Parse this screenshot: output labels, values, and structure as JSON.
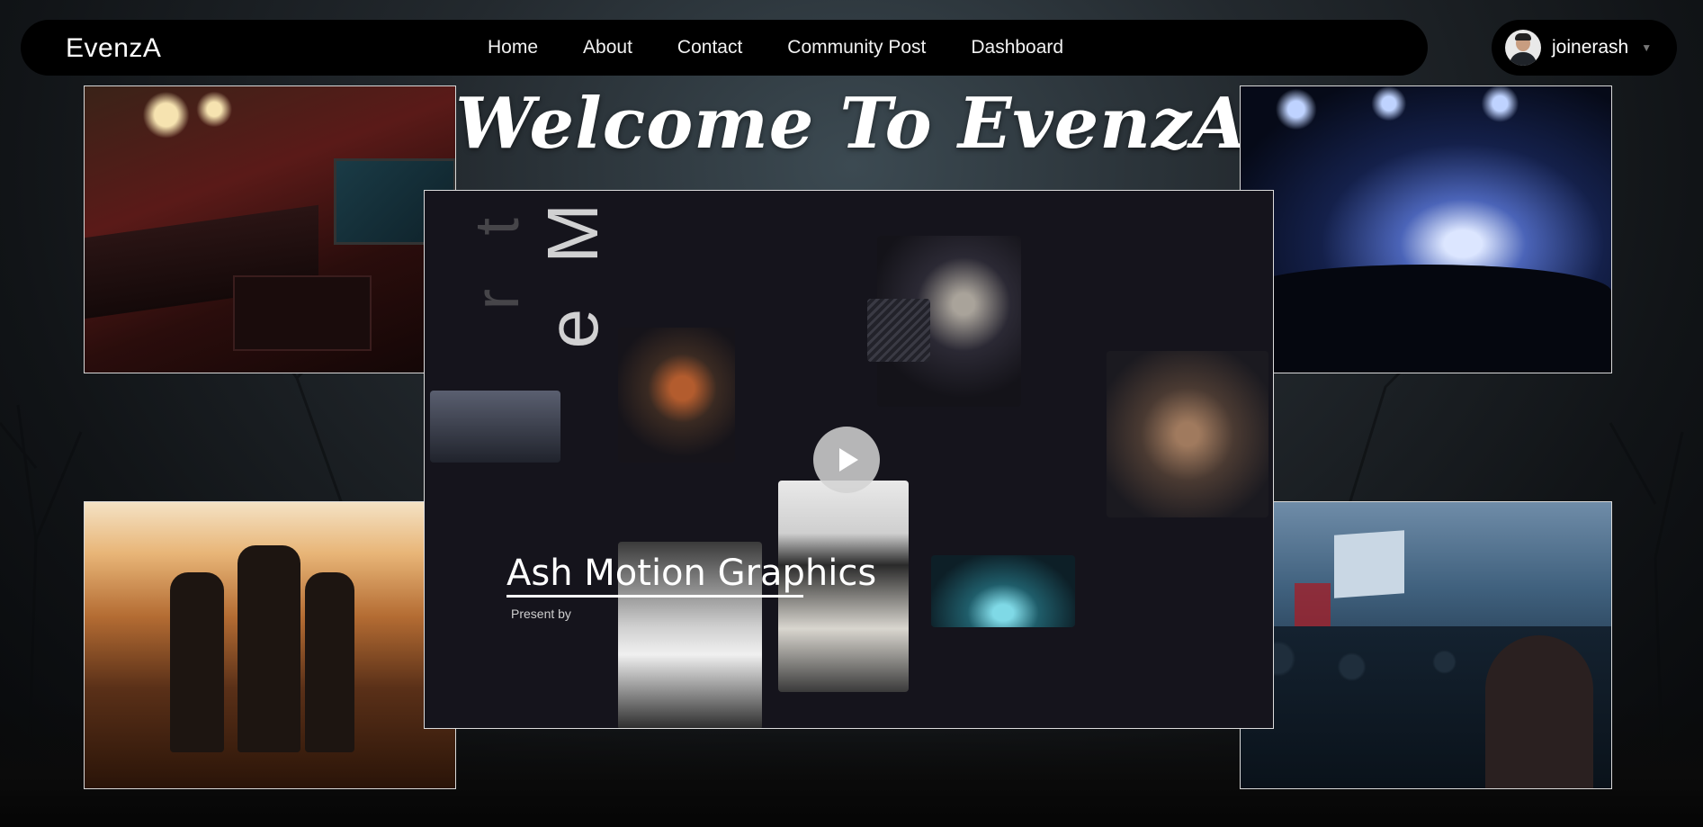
{
  "brand": {
    "name": "EvenzA"
  },
  "nav": {
    "links": [
      {
        "label": "Home"
      },
      {
        "label": "About"
      },
      {
        "label": "Contact"
      },
      {
        "label": "Community Post"
      },
      {
        "label": "Dashboard"
      }
    ]
  },
  "user": {
    "name": "joinerash",
    "avatar_icon": "user-avatar-icon"
  },
  "hero": {
    "title": "Welcome To EvenzA"
  },
  "video": {
    "title": "Ash Motion Graphics",
    "subtitle": "Present by",
    "vertical_text": "e M",
    "vertical_text_faded": "r t",
    "play_icon": "play-icon"
  },
  "colors": {
    "nav_bg": "#000000",
    "text": "#ffffff",
    "play_button": "#d2d2d2"
  }
}
